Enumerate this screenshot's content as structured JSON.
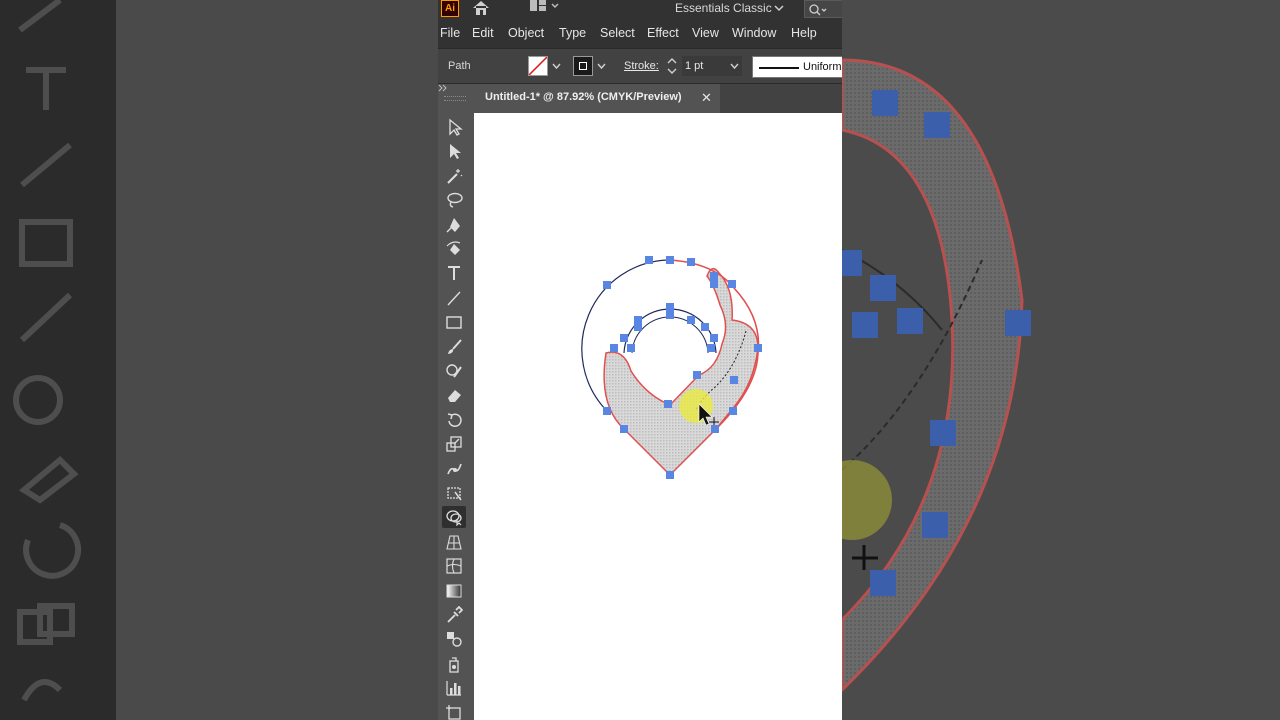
{
  "app": {
    "logo": "Ai",
    "workspace": "Essentials Classic"
  },
  "menu": [
    "File",
    "Edit",
    "Object",
    "Type",
    "Select",
    "Effect",
    "View",
    "Window",
    "Help"
  ],
  "control_bar": {
    "selection_type": "Path",
    "stroke_label": "Stroke:",
    "stroke_weight": "1 pt",
    "profile": "Uniform"
  },
  "document": {
    "tab_title": "Untitled-1* @ 87.92% (CMYK/Preview)",
    "close_symbol": "✕"
  },
  "tools": [
    {
      "name": "selection-tool-icon",
      "active": false
    },
    {
      "name": "direct-selection-tool-icon",
      "active": false
    },
    {
      "name": "magic-wand-tool-icon",
      "active": false
    },
    {
      "name": "lasso-tool-icon",
      "active": false
    },
    {
      "name": "pen-tool-icon",
      "active": false
    },
    {
      "name": "curvature-tool-icon",
      "active": false
    },
    {
      "name": "type-tool-icon",
      "active": false
    },
    {
      "name": "line-segment-tool-icon",
      "active": false
    },
    {
      "name": "rectangle-tool-icon",
      "active": false
    },
    {
      "name": "paintbrush-tool-icon",
      "active": false
    },
    {
      "name": "shaper-tool-icon",
      "active": false
    },
    {
      "name": "eraser-tool-icon",
      "active": false
    },
    {
      "name": "rotate-tool-icon",
      "active": false
    },
    {
      "name": "scale-tool-icon",
      "active": false
    },
    {
      "name": "puppet-warp-tool-icon",
      "active": false
    },
    {
      "name": "free-transform-tool-icon",
      "active": false
    },
    {
      "name": "shape-builder-tool-icon",
      "active": true
    },
    {
      "name": "perspective-grid-tool-icon",
      "active": false
    },
    {
      "name": "mesh-tool-icon",
      "active": false
    },
    {
      "name": "gradient-tool-icon",
      "active": false
    },
    {
      "name": "eyedropper-tool-icon",
      "active": false
    },
    {
      "name": "blend-tool-icon",
      "active": false
    },
    {
      "name": "symbol-sprayer-tool-icon",
      "active": false
    },
    {
      "name": "column-graph-tool-icon",
      "active": false
    },
    {
      "name": "artboard-tool-icon",
      "active": false
    }
  ],
  "colors": {
    "selection": "#4f7fe0",
    "highlight_stroke": "#e05050",
    "cursor_highlight": "#e8e840"
  }
}
